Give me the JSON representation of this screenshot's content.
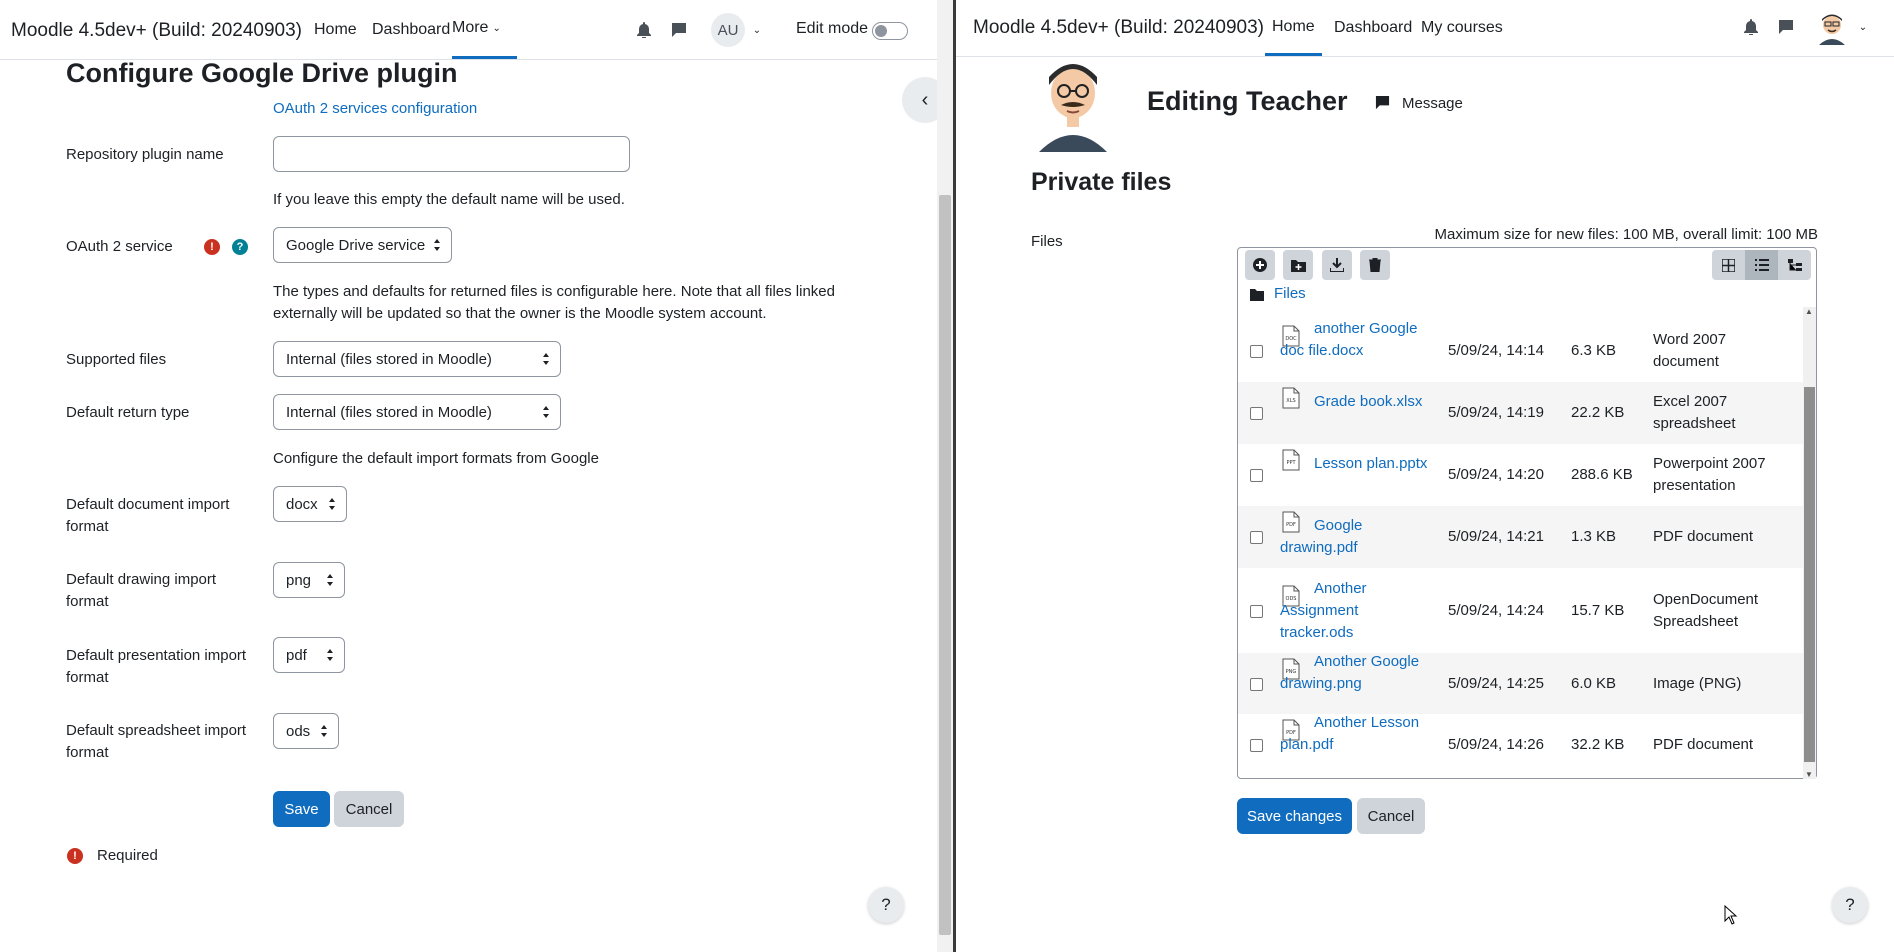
{
  "left": {
    "brand": "Moodle 4.5dev+ (Build: 20240903)",
    "nav": [
      "Home",
      "Dashboard",
      "More"
    ],
    "user_initials": "AU",
    "edit_mode_label": "Edit mode",
    "page_title": "Configure Google Drive plugin",
    "oauth_link": "OAuth 2 services configuration",
    "fields": {
      "repo_name_label": "Repository plugin name",
      "repo_name_value": "",
      "repo_name_help": "If you leave this empty the default name will be used.",
      "oauth_label": "OAuth 2 service",
      "oauth_value": "Google Drive service",
      "types_help": "The types and defaults for returned files is configurable here. Note that all files linked externally will be updated so that the owner is the Moodle system account.",
      "supported_label": "Supported files",
      "supported_value": "Internal (files stored in Moodle)",
      "return_label": "Default return type",
      "return_value": "Internal (files stored in Moodle)",
      "import_help": "Configure the default import formats from Google",
      "doc_label": "Default document import format",
      "doc_value": "docx",
      "drawing_label": "Default drawing import format",
      "drawing_value": "png",
      "presentation_label": "Default presentation import format",
      "presentation_value": "pdf",
      "spreadsheet_label": "Default spreadsheet import format",
      "spreadsheet_value": "ods"
    },
    "save_label": "Save",
    "cancel_label": "Cancel",
    "required_label": "Required",
    "help_glyph": "?"
  },
  "right": {
    "brand": "Moodle 4.5dev+ (Build: 20240903)",
    "nav": [
      "Home",
      "Dashboard",
      "My courses"
    ],
    "profile_name": "Editing Teacher",
    "message_label": "Message",
    "section_title": "Private files",
    "files_label": "Files",
    "max_size_text": "Maximum size for new files: 100 MB, overall limit: 100 MB",
    "breadcrumb": "Files",
    "files": [
      {
        "name": "another Google doc file.docx",
        "date": "5/09/24, 14:14",
        "size": "6.3 KB",
        "type": "Word 2007 document",
        "icon": "DOC"
      },
      {
        "name": "Grade book.xlsx",
        "date": "5/09/24, 14:19",
        "size": "22.2 KB",
        "type": "Excel 2007 spreadsheet",
        "icon": "XLS"
      },
      {
        "name": "Lesson plan.pptx",
        "date": "5/09/24, 14:20",
        "size": "288.6 KB",
        "type": "Powerpoint 2007 presentation",
        "icon": "PPT"
      },
      {
        "name": "Google drawing.pdf",
        "date": "5/09/24, 14:21",
        "size": "1.3 KB",
        "type": "PDF document",
        "icon": "PDF"
      },
      {
        "name": "Another Assignment tracker.ods",
        "date": "5/09/24, 14:24",
        "size": "15.7 KB",
        "type": "OpenDocument Spreadsheet",
        "icon": "ODS"
      },
      {
        "name": "Another Google drawing.png",
        "date": "5/09/24, 14:25",
        "size": "6.0 KB",
        "type": "Image (PNG)",
        "icon": "PNG"
      },
      {
        "name": "Another Lesson plan.pdf",
        "date": "5/09/24, 14:26",
        "size": "32.2 KB",
        "type": "PDF document",
        "icon": "PDF"
      }
    ],
    "save_changes_label": "Save changes",
    "cancel_label": "Cancel",
    "help_glyph": "?"
  },
  "colors": {
    "primary": "#0f6cbf",
    "required": "#ca3120",
    "info": "#008196"
  }
}
